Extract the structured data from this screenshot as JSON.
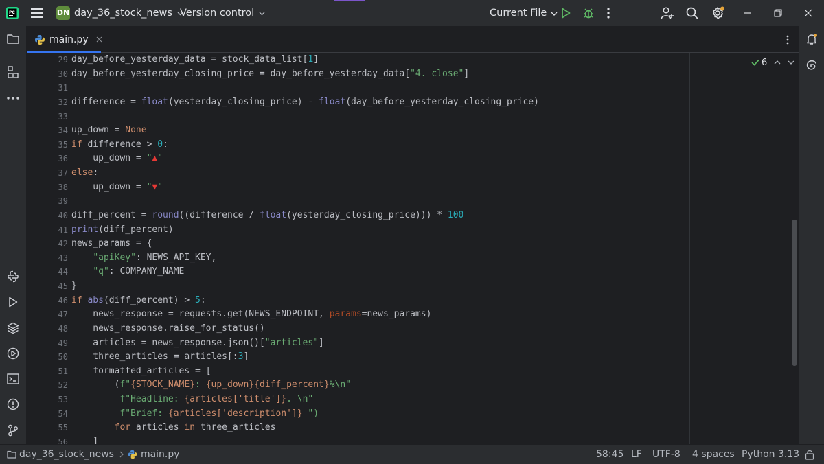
{
  "titlebar": {
    "project_badge": "DN",
    "project_name": "day_36_stock_news",
    "vcs_label": "Version control",
    "run_config": "Current File"
  },
  "tabs": [
    {
      "label": "main.py"
    }
  ],
  "inspections": {
    "count": "6"
  },
  "code": {
    "lines": [
      {
        "n": "29"
      },
      {
        "n": "30"
      },
      {
        "n": "31"
      },
      {
        "n": "32"
      },
      {
        "n": "33"
      },
      {
        "n": "34"
      },
      {
        "n": "35"
      },
      {
        "n": "36"
      },
      {
        "n": "37"
      },
      {
        "n": "38"
      },
      {
        "n": "39"
      },
      {
        "n": "40"
      },
      {
        "n": "41"
      },
      {
        "n": "42"
      },
      {
        "n": "43"
      },
      {
        "n": "44"
      },
      {
        "n": "45"
      },
      {
        "n": "46"
      },
      {
        "n": "47"
      },
      {
        "n": "48"
      },
      {
        "n": "49"
      },
      {
        "n": "50"
      },
      {
        "n": "51"
      },
      {
        "n": "52"
      },
      {
        "n": "53"
      },
      {
        "n": "54"
      },
      {
        "n": "55"
      },
      {
        "n": "56"
      }
    ],
    "text": {
      "l29": [
        "day_before_yesterday_data = stock_data_list[",
        "1",
        "]"
      ],
      "l30": [
        "day_before_yesterday_closing_price = day_before_yesterday_data[",
        "\"4. close\"",
        "]"
      ],
      "l32": [
        "difference = ",
        "float",
        "(yesterday_closing_price) - ",
        "float",
        "(day_before_yesterday_closing_price)"
      ],
      "l34": [
        "up_down = ",
        "None"
      ],
      "l35": [
        "if",
        " difference > ",
        "0",
        ":"
      ],
      "l36": [
        "    up_down = ",
        "\"",
        "▲",
        "\""
      ],
      "l37": [
        "else",
        ":"
      ],
      "l38": [
        "    up_down = ",
        "\"",
        "▼",
        "\""
      ],
      "l40": [
        "diff_percent = ",
        "round",
        "((difference / ",
        "float",
        "(yesterday_closing_price))) * ",
        "100"
      ],
      "l41": [
        "print",
        "(diff_percent)"
      ],
      "l42": [
        "news_params = {"
      ],
      "l43": [
        "    ",
        "\"apiKey\"",
        ": NEWS_API_KEY,"
      ],
      "l44": [
        "    ",
        "\"q\"",
        ": COMPANY_NAME"
      ],
      "l45": [
        "}"
      ],
      "l46": [
        "if",
        " ",
        "abs",
        "(diff_percent) > ",
        "5",
        ":"
      ],
      "l47": [
        "    news_response = requests.get(NEWS_ENDPOINT, ",
        "params",
        "=news_params)"
      ],
      "l48": [
        "    news_response.raise_for_status()"
      ],
      "l49": [
        "    articles = news_response.json()[",
        "\"articles\"",
        "]"
      ],
      "l50": [
        "    three_articles = articles[:",
        "3",
        "]"
      ],
      "l51": [
        "    formatted_articles = ["
      ],
      "l52": [
        "        (",
        "f\"",
        "{STOCK_NAME}",
        ": ",
        "{up_down}{diff_percent}",
        "%\\n\""
      ],
      "l53": [
        "         ",
        "f\"Headline: ",
        "{articles['title']}",
        ". \\n\""
      ],
      "l54": [
        "         ",
        "f\"Brief: ",
        "{articles['description']}",
        " \")"
      ],
      "l55": [
        "        ",
        "for",
        " articles ",
        "in",
        " three_articles"
      ],
      "l56": [
        "    ]"
      ]
    }
  },
  "statusbar": {
    "breadcrumb_project": "day_36_stock_news",
    "breadcrumb_file": "main.py",
    "position": "58:45",
    "line_ending": "LF",
    "encoding": "UTF-8",
    "indent": "4 spaces",
    "interpreter": "Python 3.13"
  },
  "colors": {
    "accent": "#3574f0",
    "keyword": "#cf8e6d",
    "string": "#6aab73",
    "number": "#2aacb8",
    "builtin": "#8888c6",
    "run_green": "#5fb865",
    "project_badge": "#5f8c3c"
  },
  "icons": {
    "app_logo": "pycharm-logo",
    "menu": "hamburger-icon",
    "run": "run-icon",
    "debug": "debug-icon",
    "more": "more-vertical-icon",
    "add_user": "add-user-icon",
    "search": "search-icon",
    "settings": "gear-icon"
  }
}
